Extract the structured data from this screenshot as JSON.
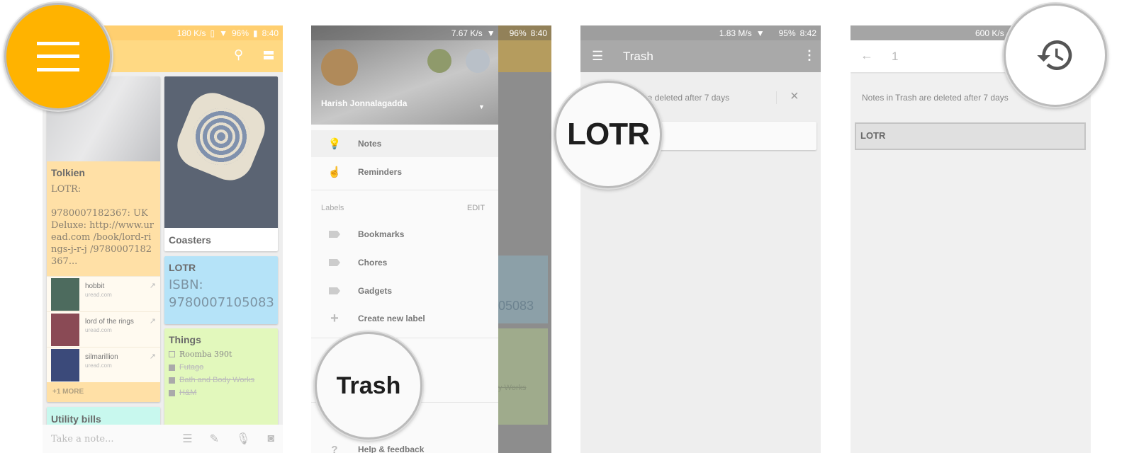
{
  "panel1": {
    "status": {
      "speed": "180 K/s",
      "battery": "96%",
      "time": "8:40"
    },
    "toolbar": {
      "search_icon": "search-icon",
      "view_icon": "list-view-icon"
    },
    "notes": [
      {
        "title": "Tolkien",
        "body": [
          "LOTR:",
          "",
          "9780007182367: UK Deluxe: http://www.uread.com /book/lord-rings-j-r-j /9780007182367..."
        ],
        "links": [
          {
            "name": "hobbit",
            "domain": "uread.com"
          },
          {
            "name": "lord of the rings",
            "domain": "uread.com"
          },
          {
            "name": "silmarillion",
            "domain": "uread.com"
          }
        ],
        "more": "+1 MORE",
        "color": "#FFE0A6"
      },
      {
        "title": "Coasters",
        "color": "#FFFFFF"
      },
      {
        "title": "LOTR",
        "body": "ISBN: 9780007105083",
        "color": "#B5E3F8"
      },
      {
        "title": "Things",
        "items": [
          {
            "text": "Roomba 390t",
            "checked": false
          },
          {
            "text": "Futago",
            "checked": true
          },
          {
            "text": "Bath and Body Works",
            "checked": true
          },
          {
            "text": "H&M",
            "checked": true
          }
        ],
        "color": "#E2F8BC"
      },
      {
        "title": "Utility bills",
        "color": "#C8F8EE"
      }
    ],
    "take_note_placeholder": "Take a note...",
    "accent": "#FFB300"
  },
  "panel2": {
    "status": {
      "speed": "7.67 K/s",
      "battery": "96%",
      "time": "8:40"
    },
    "account_name": "Harish Jonnalagadda",
    "items": [
      {
        "label": "Notes",
        "icon": "lightbulb-icon"
      },
      {
        "label": "Reminders",
        "icon": "reminder-hand-icon"
      }
    ],
    "labels_header": "Labels",
    "edit": "EDIT",
    "labels": [
      "Bookmarks",
      "Chores",
      "Gadgets"
    ],
    "create_label": "Create new label",
    "trash": "Trash",
    "help": "Help & feedback",
    "bg_isbn": "05083",
    "bg_works": "y Works"
  },
  "panel3": {
    "status": {
      "speed": "1.83 M/s",
      "battery": "95%",
      "time": "8:42"
    },
    "title": "Trash",
    "notice": "are deleted after 7 days",
    "note": "LOTR"
  },
  "panel4": {
    "status": {
      "speed": "600 K/s"
    },
    "selected_count": "1",
    "notice": "Notes in Trash are deleted after 7 days",
    "note": "LOTR",
    "restore_icon": "restore-icon"
  }
}
